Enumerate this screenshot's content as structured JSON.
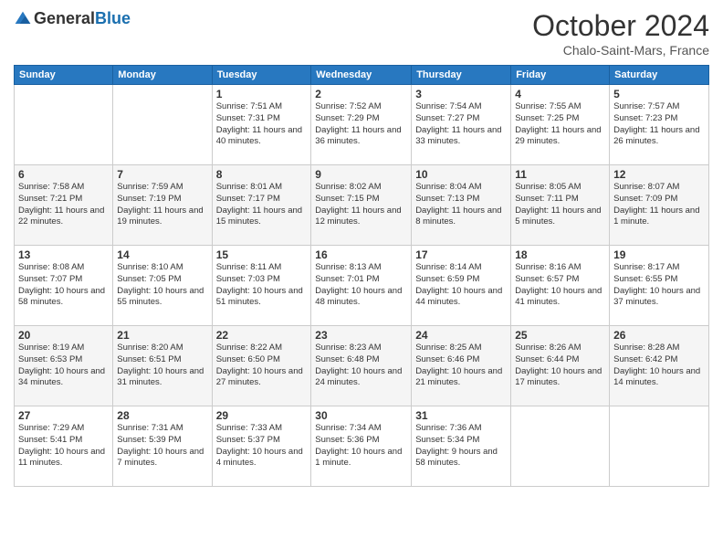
{
  "header": {
    "logo": {
      "text_general": "General",
      "text_blue": "Blue"
    },
    "title": "October 2024",
    "subtitle": "Chalo-Saint-Mars, France"
  },
  "columns": [
    "Sunday",
    "Monday",
    "Tuesday",
    "Wednesday",
    "Thursday",
    "Friday",
    "Saturday"
  ],
  "weeks": [
    [
      {
        "day": "",
        "info": ""
      },
      {
        "day": "",
        "info": ""
      },
      {
        "day": "1",
        "info": "Sunrise: 7:51 AM\nSunset: 7:31 PM\nDaylight: 11 hours and 40 minutes."
      },
      {
        "day": "2",
        "info": "Sunrise: 7:52 AM\nSunset: 7:29 PM\nDaylight: 11 hours and 36 minutes."
      },
      {
        "day": "3",
        "info": "Sunrise: 7:54 AM\nSunset: 7:27 PM\nDaylight: 11 hours and 33 minutes."
      },
      {
        "day": "4",
        "info": "Sunrise: 7:55 AM\nSunset: 7:25 PM\nDaylight: 11 hours and 29 minutes."
      },
      {
        "day": "5",
        "info": "Sunrise: 7:57 AM\nSunset: 7:23 PM\nDaylight: 11 hours and 26 minutes."
      }
    ],
    [
      {
        "day": "6",
        "info": "Sunrise: 7:58 AM\nSunset: 7:21 PM\nDaylight: 11 hours and 22 minutes."
      },
      {
        "day": "7",
        "info": "Sunrise: 7:59 AM\nSunset: 7:19 PM\nDaylight: 11 hours and 19 minutes."
      },
      {
        "day": "8",
        "info": "Sunrise: 8:01 AM\nSunset: 7:17 PM\nDaylight: 11 hours and 15 minutes."
      },
      {
        "day": "9",
        "info": "Sunrise: 8:02 AM\nSunset: 7:15 PM\nDaylight: 11 hours and 12 minutes."
      },
      {
        "day": "10",
        "info": "Sunrise: 8:04 AM\nSunset: 7:13 PM\nDaylight: 11 hours and 8 minutes."
      },
      {
        "day": "11",
        "info": "Sunrise: 8:05 AM\nSunset: 7:11 PM\nDaylight: 11 hours and 5 minutes."
      },
      {
        "day": "12",
        "info": "Sunrise: 8:07 AM\nSunset: 7:09 PM\nDaylight: 11 hours and 1 minute."
      }
    ],
    [
      {
        "day": "13",
        "info": "Sunrise: 8:08 AM\nSunset: 7:07 PM\nDaylight: 10 hours and 58 minutes."
      },
      {
        "day": "14",
        "info": "Sunrise: 8:10 AM\nSunset: 7:05 PM\nDaylight: 10 hours and 55 minutes."
      },
      {
        "day": "15",
        "info": "Sunrise: 8:11 AM\nSunset: 7:03 PM\nDaylight: 10 hours and 51 minutes."
      },
      {
        "day": "16",
        "info": "Sunrise: 8:13 AM\nSunset: 7:01 PM\nDaylight: 10 hours and 48 minutes."
      },
      {
        "day": "17",
        "info": "Sunrise: 8:14 AM\nSunset: 6:59 PM\nDaylight: 10 hours and 44 minutes."
      },
      {
        "day": "18",
        "info": "Sunrise: 8:16 AM\nSunset: 6:57 PM\nDaylight: 10 hours and 41 minutes."
      },
      {
        "day": "19",
        "info": "Sunrise: 8:17 AM\nSunset: 6:55 PM\nDaylight: 10 hours and 37 minutes."
      }
    ],
    [
      {
        "day": "20",
        "info": "Sunrise: 8:19 AM\nSunset: 6:53 PM\nDaylight: 10 hours and 34 minutes."
      },
      {
        "day": "21",
        "info": "Sunrise: 8:20 AM\nSunset: 6:51 PM\nDaylight: 10 hours and 31 minutes."
      },
      {
        "day": "22",
        "info": "Sunrise: 8:22 AM\nSunset: 6:50 PM\nDaylight: 10 hours and 27 minutes."
      },
      {
        "day": "23",
        "info": "Sunrise: 8:23 AM\nSunset: 6:48 PM\nDaylight: 10 hours and 24 minutes."
      },
      {
        "day": "24",
        "info": "Sunrise: 8:25 AM\nSunset: 6:46 PM\nDaylight: 10 hours and 21 minutes."
      },
      {
        "day": "25",
        "info": "Sunrise: 8:26 AM\nSunset: 6:44 PM\nDaylight: 10 hours and 17 minutes."
      },
      {
        "day": "26",
        "info": "Sunrise: 8:28 AM\nSunset: 6:42 PM\nDaylight: 10 hours and 14 minutes."
      }
    ],
    [
      {
        "day": "27",
        "info": "Sunrise: 7:29 AM\nSunset: 5:41 PM\nDaylight: 10 hours and 11 minutes."
      },
      {
        "day": "28",
        "info": "Sunrise: 7:31 AM\nSunset: 5:39 PM\nDaylight: 10 hours and 7 minutes."
      },
      {
        "day": "29",
        "info": "Sunrise: 7:33 AM\nSunset: 5:37 PM\nDaylight: 10 hours and 4 minutes."
      },
      {
        "day": "30",
        "info": "Sunrise: 7:34 AM\nSunset: 5:36 PM\nDaylight: 10 hours and 1 minute."
      },
      {
        "day": "31",
        "info": "Sunrise: 7:36 AM\nSunset: 5:34 PM\nDaylight: 9 hours and 58 minutes."
      },
      {
        "day": "",
        "info": ""
      },
      {
        "day": "",
        "info": ""
      }
    ]
  ]
}
